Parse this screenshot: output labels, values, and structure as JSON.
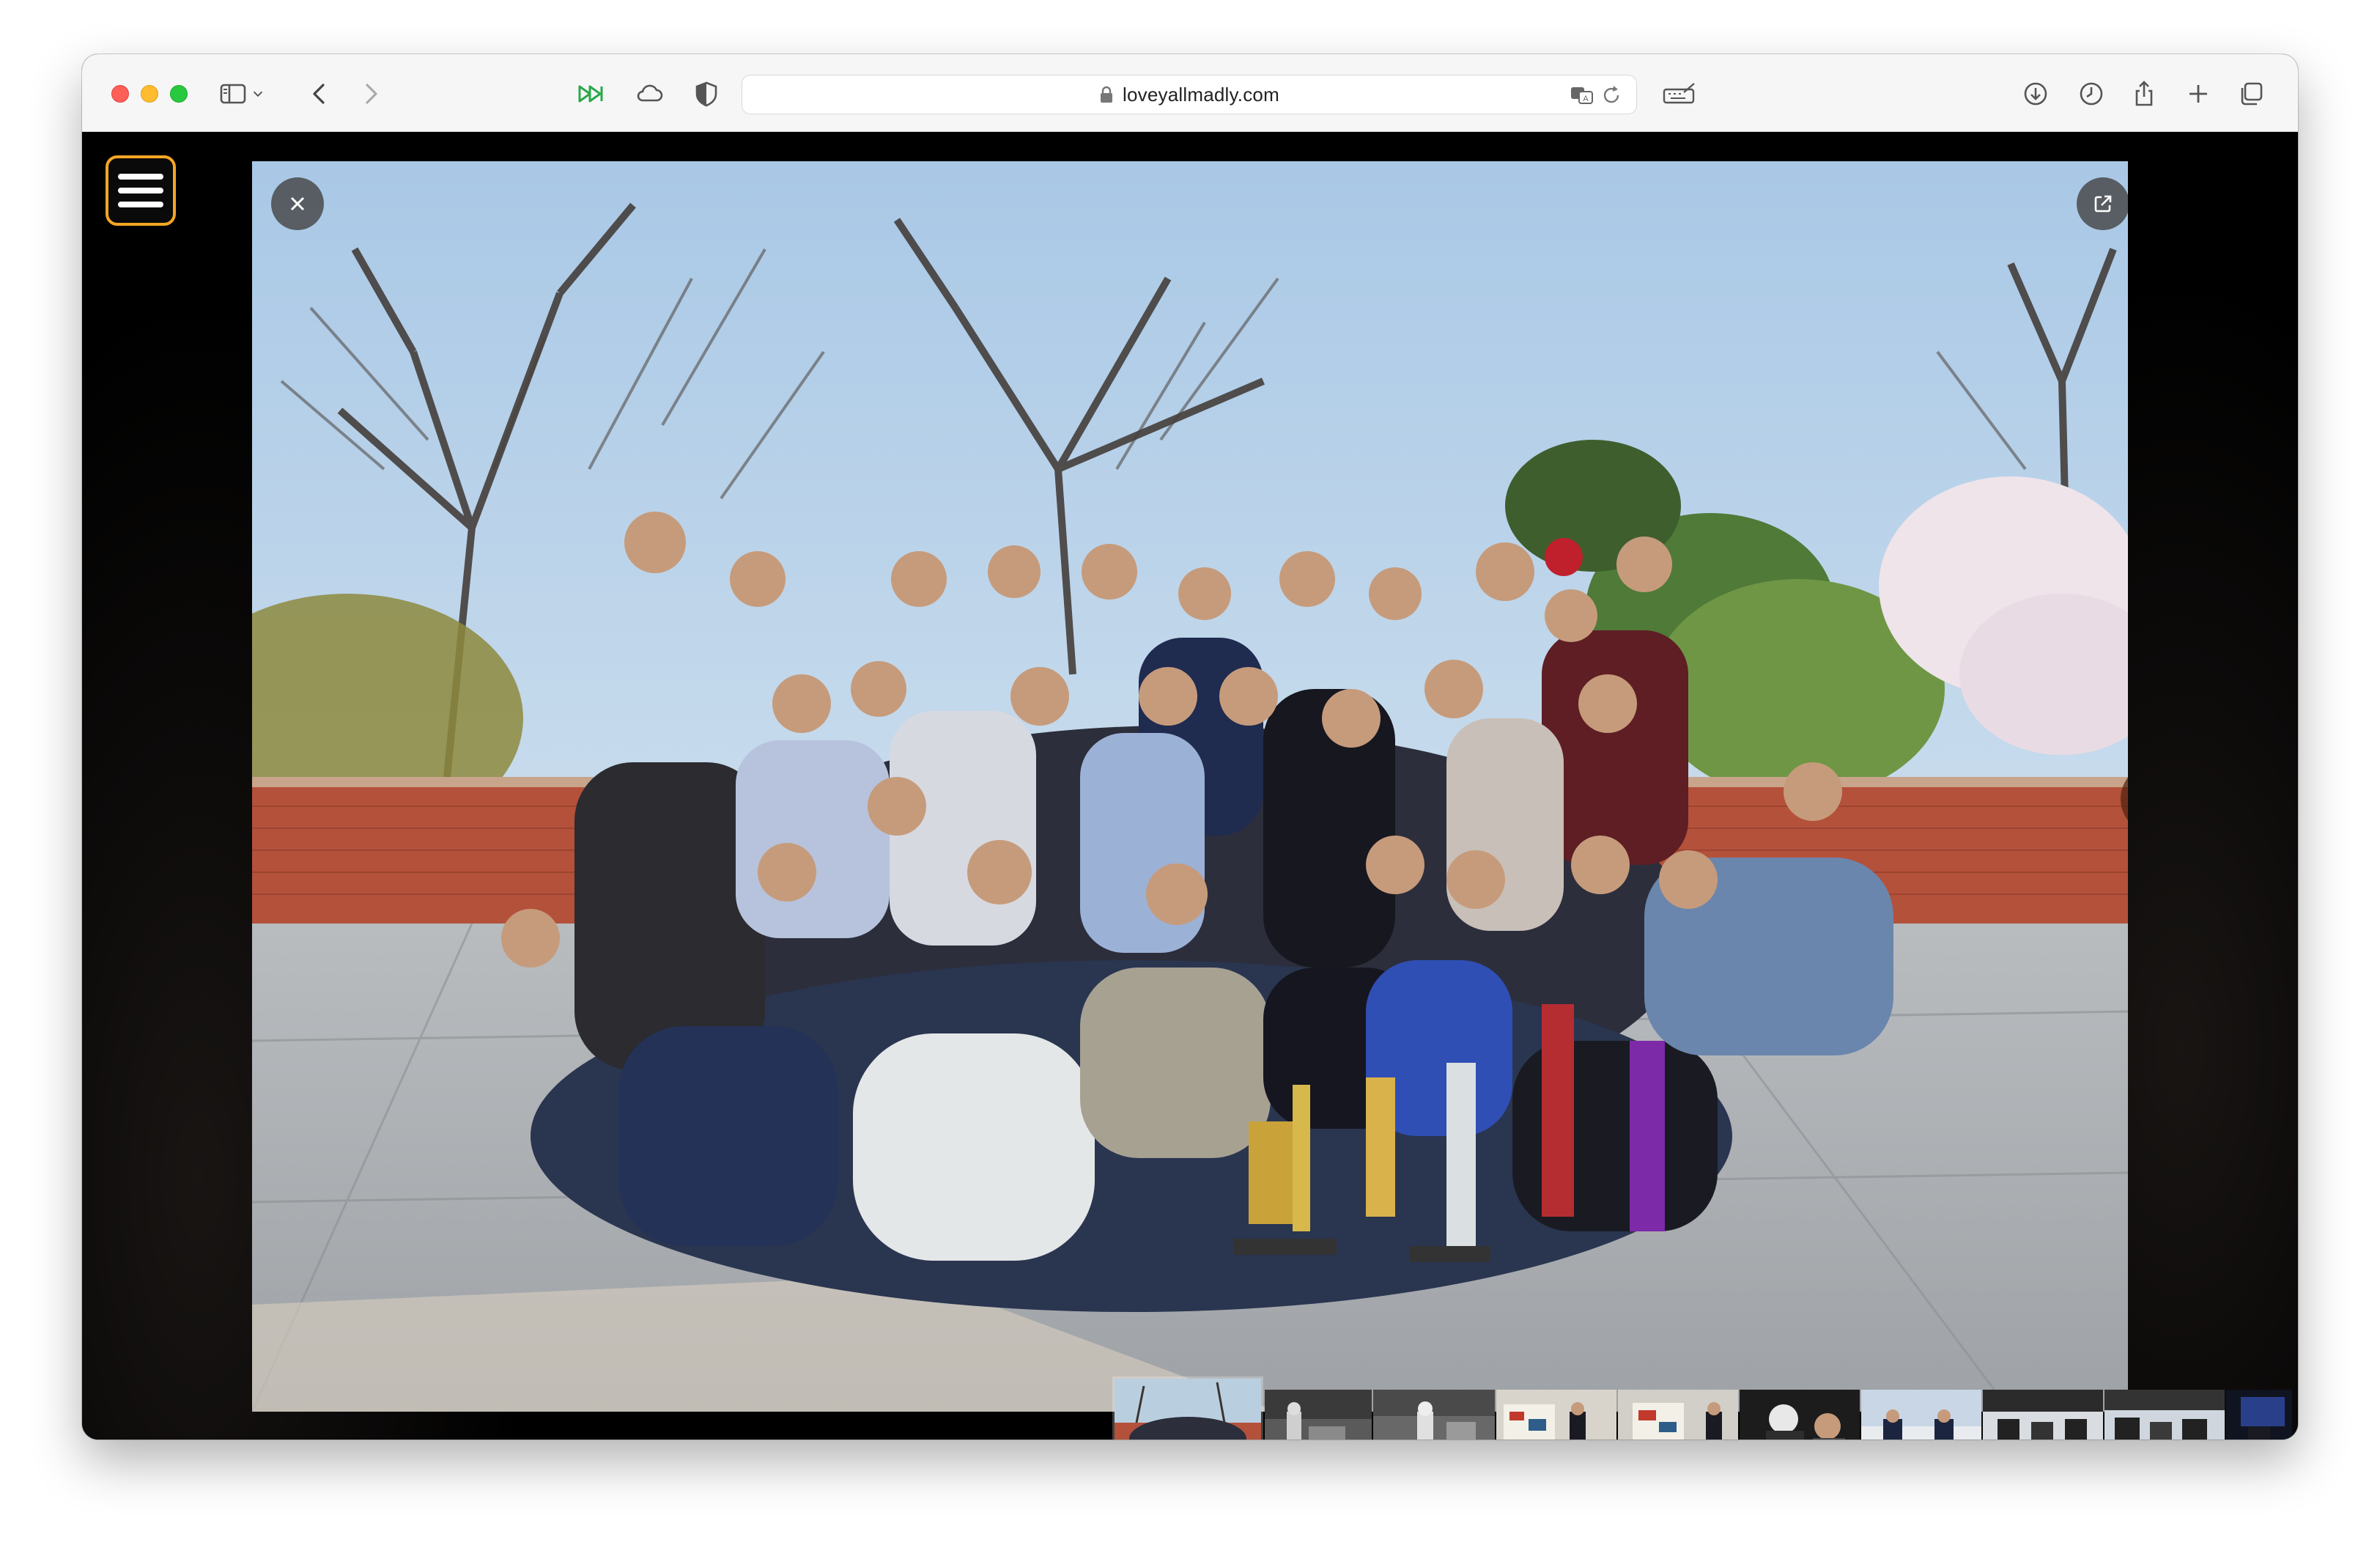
{
  "browser": {
    "url": "loveyallmadly.com",
    "icons": {
      "sidebar": "sidebar-icon",
      "chevron": "chevron-down-icon",
      "back": "back-arrow-icon",
      "forward": "forward-arrow-icon",
      "fast_forward": "fast-forward-icon",
      "cloud": "cloud-icon",
      "shield": "shield-icon",
      "lock": "lock-icon",
      "translate": "translate-icon",
      "reload": "reload-icon",
      "keyboard": "keyboard-icon",
      "downloads": "download-circle-icon",
      "history": "clock-icon",
      "share": "share-icon",
      "new_tab": "plus-icon",
      "tab_overview": "tabs-icon"
    }
  },
  "lightbox": {
    "menu_icon": "hamburger-menu-icon",
    "close_icon": "close-icon",
    "open_external_icon": "external-link-icon",
    "download_icon": "download-icon",
    "next_icon": "chevron-right-icon",
    "thumbnail_count": 11,
    "active_thumbnail": 1
  },
  "colors": {
    "menu_border": "#f5a623",
    "sky": "#cfe0ee",
    "brick": "#b4513a",
    "pavement": "#a9adb1"
  }
}
